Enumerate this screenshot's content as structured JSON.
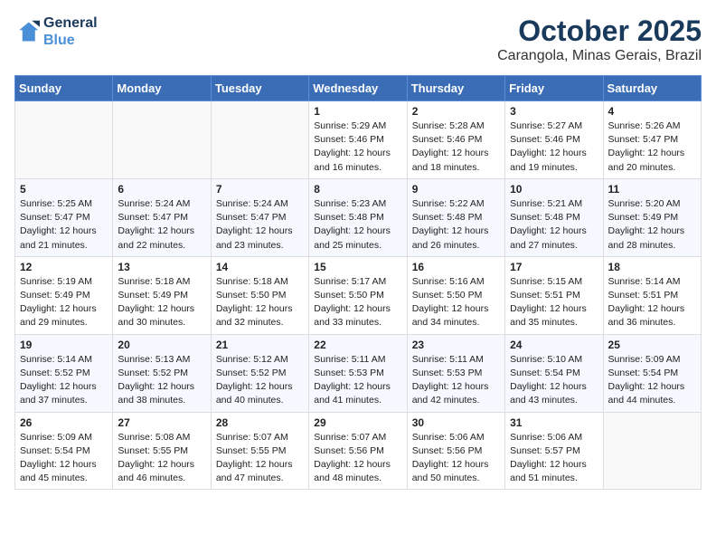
{
  "logo": {
    "line1": "General",
    "line2": "Blue"
  },
  "title": "October 2025",
  "location": "Carangola, Minas Gerais, Brazil",
  "weekdays": [
    "Sunday",
    "Monday",
    "Tuesday",
    "Wednesday",
    "Thursday",
    "Friday",
    "Saturday"
  ],
  "weeks": [
    [
      {
        "day": "",
        "info": ""
      },
      {
        "day": "",
        "info": ""
      },
      {
        "day": "",
        "info": ""
      },
      {
        "day": "1",
        "info": "Sunrise: 5:29 AM\nSunset: 5:46 PM\nDaylight: 12 hours\nand 16 minutes."
      },
      {
        "day": "2",
        "info": "Sunrise: 5:28 AM\nSunset: 5:46 PM\nDaylight: 12 hours\nand 18 minutes."
      },
      {
        "day": "3",
        "info": "Sunrise: 5:27 AM\nSunset: 5:46 PM\nDaylight: 12 hours\nand 19 minutes."
      },
      {
        "day": "4",
        "info": "Sunrise: 5:26 AM\nSunset: 5:47 PM\nDaylight: 12 hours\nand 20 minutes."
      }
    ],
    [
      {
        "day": "5",
        "info": "Sunrise: 5:25 AM\nSunset: 5:47 PM\nDaylight: 12 hours\nand 21 minutes."
      },
      {
        "day": "6",
        "info": "Sunrise: 5:24 AM\nSunset: 5:47 PM\nDaylight: 12 hours\nand 22 minutes."
      },
      {
        "day": "7",
        "info": "Sunrise: 5:24 AM\nSunset: 5:47 PM\nDaylight: 12 hours\nand 23 minutes."
      },
      {
        "day": "8",
        "info": "Sunrise: 5:23 AM\nSunset: 5:48 PM\nDaylight: 12 hours\nand 25 minutes."
      },
      {
        "day": "9",
        "info": "Sunrise: 5:22 AM\nSunset: 5:48 PM\nDaylight: 12 hours\nand 26 minutes."
      },
      {
        "day": "10",
        "info": "Sunrise: 5:21 AM\nSunset: 5:48 PM\nDaylight: 12 hours\nand 27 minutes."
      },
      {
        "day": "11",
        "info": "Sunrise: 5:20 AM\nSunset: 5:49 PM\nDaylight: 12 hours\nand 28 minutes."
      }
    ],
    [
      {
        "day": "12",
        "info": "Sunrise: 5:19 AM\nSunset: 5:49 PM\nDaylight: 12 hours\nand 29 minutes."
      },
      {
        "day": "13",
        "info": "Sunrise: 5:18 AM\nSunset: 5:49 PM\nDaylight: 12 hours\nand 30 minutes."
      },
      {
        "day": "14",
        "info": "Sunrise: 5:18 AM\nSunset: 5:50 PM\nDaylight: 12 hours\nand 32 minutes."
      },
      {
        "day": "15",
        "info": "Sunrise: 5:17 AM\nSunset: 5:50 PM\nDaylight: 12 hours\nand 33 minutes."
      },
      {
        "day": "16",
        "info": "Sunrise: 5:16 AM\nSunset: 5:50 PM\nDaylight: 12 hours\nand 34 minutes."
      },
      {
        "day": "17",
        "info": "Sunrise: 5:15 AM\nSunset: 5:51 PM\nDaylight: 12 hours\nand 35 minutes."
      },
      {
        "day": "18",
        "info": "Sunrise: 5:14 AM\nSunset: 5:51 PM\nDaylight: 12 hours\nand 36 minutes."
      }
    ],
    [
      {
        "day": "19",
        "info": "Sunrise: 5:14 AM\nSunset: 5:52 PM\nDaylight: 12 hours\nand 37 minutes."
      },
      {
        "day": "20",
        "info": "Sunrise: 5:13 AM\nSunset: 5:52 PM\nDaylight: 12 hours\nand 38 minutes."
      },
      {
        "day": "21",
        "info": "Sunrise: 5:12 AM\nSunset: 5:52 PM\nDaylight: 12 hours\nand 40 minutes."
      },
      {
        "day": "22",
        "info": "Sunrise: 5:11 AM\nSunset: 5:53 PM\nDaylight: 12 hours\nand 41 minutes."
      },
      {
        "day": "23",
        "info": "Sunrise: 5:11 AM\nSunset: 5:53 PM\nDaylight: 12 hours\nand 42 minutes."
      },
      {
        "day": "24",
        "info": "Sunrise: 5:10 AM\nSunset: 5:54 PM\nDaylight: 12 hours\nand 43 minutes."
      },
      {
        "day": "25",
        "info": "Sunrise: 5:09 AM\nSunset: 5:54 PM\nDaylight: 12 hours\nand 44 minutes."
      }
    ],
    [
      {
        "day": "26",
        "info": "Sunrise: 5:09 AM\nSunset: 5:54 PM\nDaylight: 12 hours\nand 45 minutes."
      },
      {
        "day": "27",
        "info": "Sunrise: 5:08 AM\nSunset: 5:55 PM\nDaylight: 12 hours\nand 46 minutes."
      },
      {
        "day": "28",
        "info": "Sunrise: 5:07 AM\nSunset: 5:55 PM\nDaylight: 12 hours\nand 47 minutes."
      },
      {
        "day": "29",
        "info": "Sunrise: 5:07 AM\nSunset: 5:56 PM\nDaylight: 12 hours\nand 48 minutes."
      },
      {
        "day": "30",
        "info": "Sunrise: 5:06 AM\nSunset: 5:56 PM\nDaylight: 12 hours\nand 50 minutes."
      },
      {
        "day": "31",
        "info": "Sunrise: 5:06 AM\nSunset: 5:57 PM\nDaylight: 12 hours\nand 51 minutes."
      },
      {
        "day": "",
        "info": ""
      }
    ]
  ]
}
